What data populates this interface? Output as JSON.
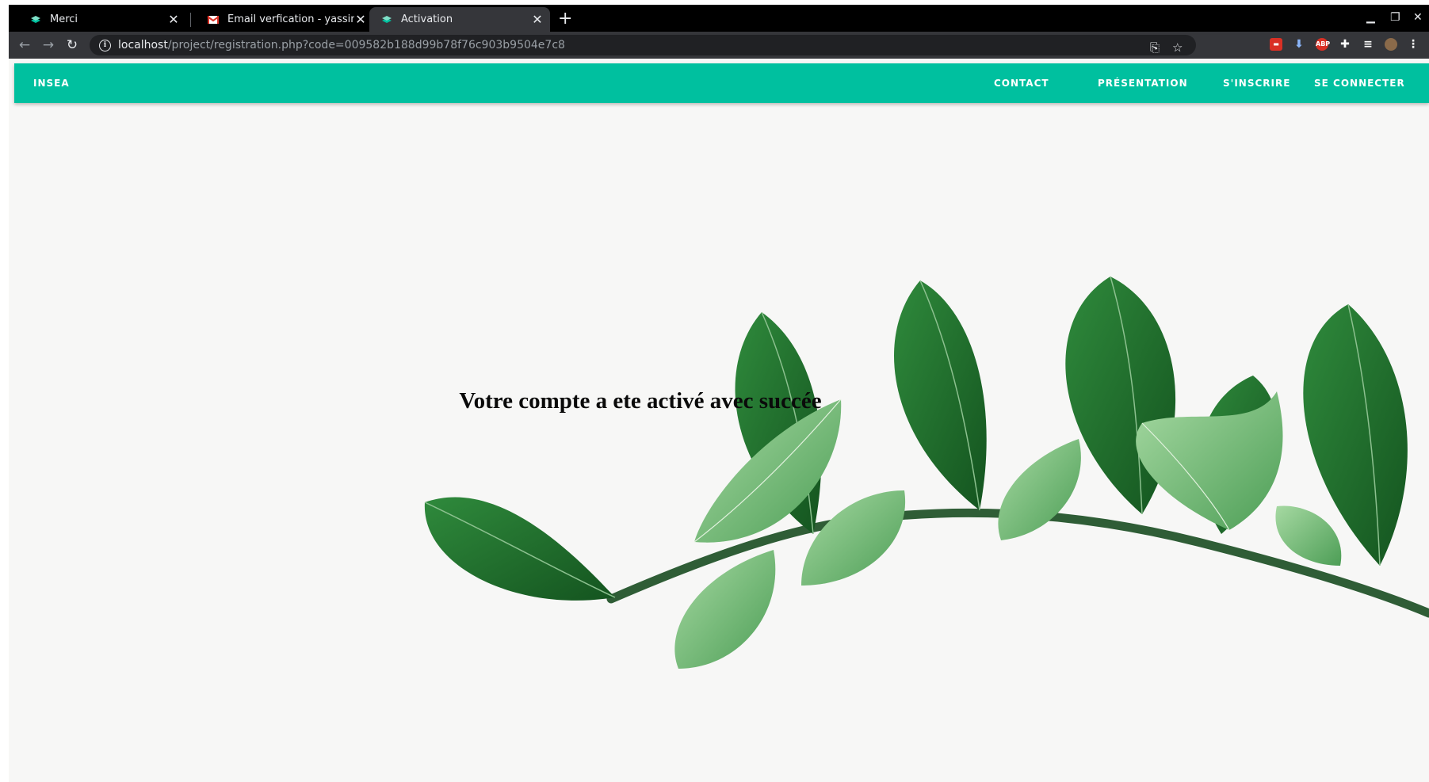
{
  "browser": {
    "tabs": [
      {
        "title": "Merci",
        "favicon": "stack-logo-icon"
      },
      {
        "title": "Email verfication - yassineaitm...",
        "favicon": "gmail-icon"
      },
      {
        "title": "Activation",
        "favicon": "stack-logo-icon",
        "active": true
      }
    ],
    "address": {
      "host": "localhost",
      "path": "/project/registration.php?code=009582b188d99b78f76c903b9504e7c8"
    }
  },
  "site": {
    "brand": "INSEA",
    "nav": [
      {
        "label": "CONTACT"
      },
      {
        "label": "PRÉSENTATION"
      },
      {
        "label": "S'INSCRIRE"
      },
      {
        "label": "SE CONNECTER"
      }
    ],
    "message": "Votre compte a ete activé avec succée"
  },
  "colors": {
    "navbar": "#00c09f",
    "leaf_dark": "#1e6e2c",
    "leaf_light": "#6fbf73",
    "background": "#f7f7f6"
  }
}
